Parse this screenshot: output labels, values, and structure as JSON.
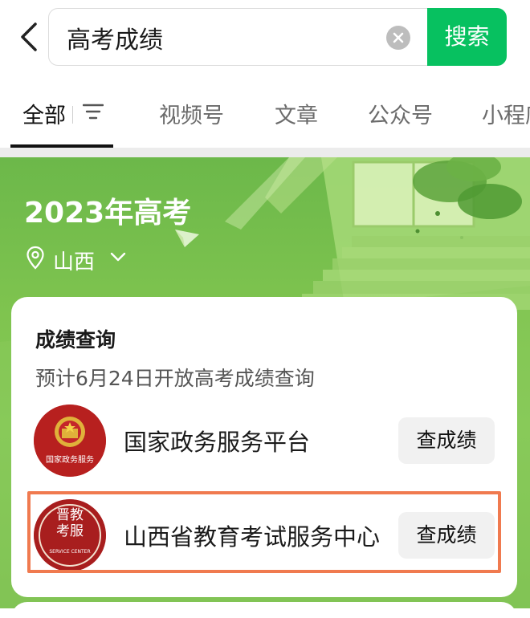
{
  "search": {
    "query": "高考成绩",
    "button_label": "搜索"
  },
  "tabs": [
    {
      "label": "全部",
      "active": true
    },
    {
      "label": "视频号"
    },
    {
      "label": "文章"
    },
    {
      "label": "公众号"
    },
    {
      "label": "小程序"
    }
  ],
  "banner": {
    "title": "2023年高考",
    "location": "山西"
  },
  "card": {
    "title": "成绩查询",
    "subtitle": "预计6月24日开放高考成绩查询",
    "services": [
      {
        "name": "国家政务服务平台",
        "button": "查成绩",
        "logo_text": "国家政务服务"
      },
      {
        "name": "山西省教育考试服务中心",
        "button": "查成绩",
        "logo_chars": [
          "晋",
          "教",
          "考",
          "服"
        ],
        "logo_text": "SERVICE CENTER",
        "highlighted": true
      }
    ]
  },
  "colors": {
    "accent": "#07c160",
    "banner_green": "#7cc050",
    "highlight": "#f07a4f",
    "logo_red": "#b7201f"
  },
  "icons": [
    "back-arrow-icon",
    "clear-icon",
    "filter-icon",
    "location-pin-icon",
    "chevron-down-icon",
    "paper-plane-icon"
  ]
}
